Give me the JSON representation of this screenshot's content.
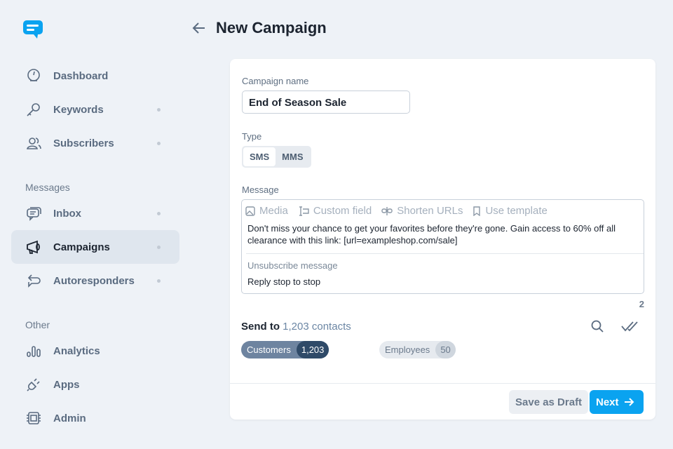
{
  "header": {
    "title": "New Campaign"
  },
  "sidebar": {
    "items": [
      {
        "label": "Dashboard"
      },
      {
        "label": "Keywords"
      },
      {
        "label": "Subscribers"
      }
    ],
    "messages_label": "Messages",
    "messages": [
      {
        "label": "Inbox"
      },
      {
        "label": "Campaigns"
      },
      {
        "label": "Autoresponders"
      }
    ],
    "other_label": "Other",
    "other": [
      {
        "label": "Analytics"
      },
      {
        "label": "Apps"
      },
      {
        "label": "Admin"
      }
    ]
  },
  "form": {
    "name_label": "Campaign name",
    "name_value": "End of Season Sale",
    "type_label": "Type",
    "types": [
      "SMS",
      "MMS"
    ],
    "message_label": "Message",
    "tools": [
      "Media",
      "Custom field",
      "Shorten URLs",
      "Use template"
    ],
    "message_body": "Don't miss your chance to get your favorites before they're gone. Gain access to 60% off all clearance with this link: [url=exampleshop.com/sale]",
    "unsub_label": "Unsubscribe message",
    "unsub_value": "Reply stop to stop",
    "segment_count": "2",
    "send_prefix": "Send to",
    "send_count": "1,203 contacts",
    "chips": [
      {
        "label": "Customers",
        "count": "1,203"
      },
      {
        "label": "Employees",
        "count": "50"
      }
    ],
    "save_draft": "Save as Draft",
    "next": "Next"
  },
  "colors": {
    "accent": "#0aa3f0",
    "chip_active": "#6e84a0"
  }
}
